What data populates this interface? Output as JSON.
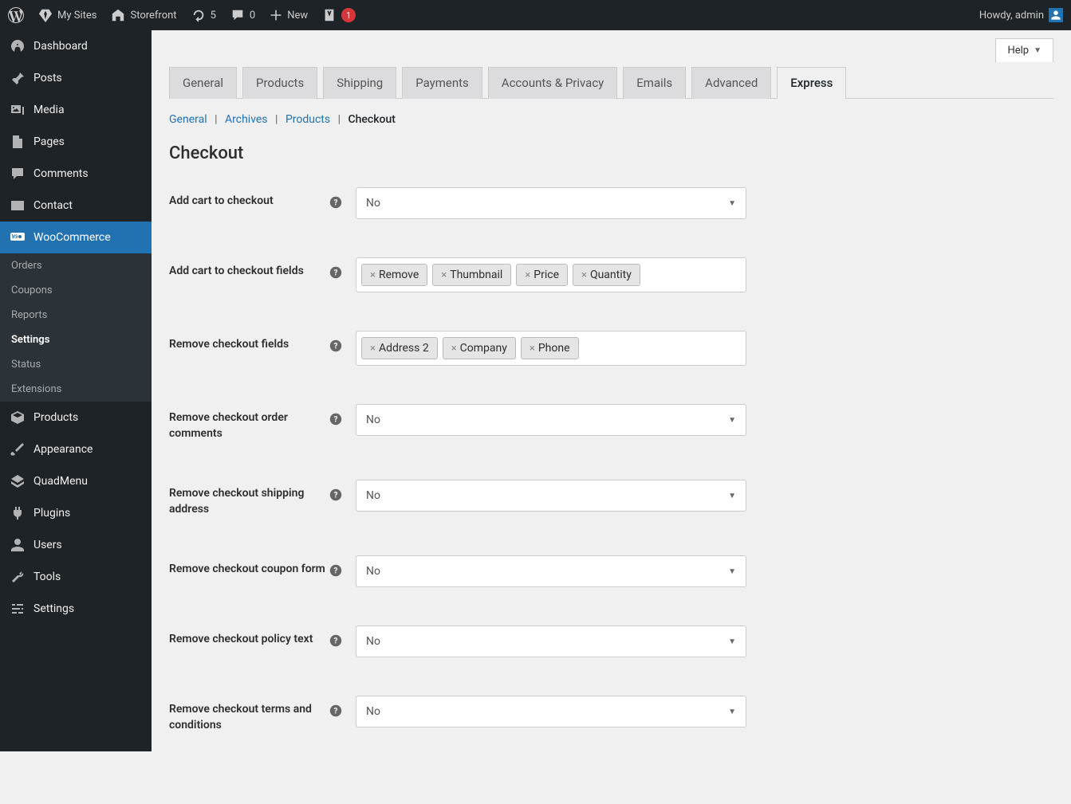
{
  "topbar": {
    "mysites": "My Sites",
    "site": "Storefront",
    "updates": "5",
    "comments": "0",
    "new": "New",
    "yoast_badge": "1",
    "howdy": "Howdy, admin"
  },
  "sidebar": {
    "items": [
      {
        "label": "Dashboard"
      },
      {
        "label": "Posts"
      },
      {
        "label": "Media"
      },
      {
        "label": "Pages"
      },
      {
        "label": "Comments"
      },
      {
        "label": "Contact"
      },
      {
        "label": "WooCommerce"
      },
      {
        "label": "Products"
      },
      {
        "label": "Appearance"
      },
      {
        "label": "QuadMenu"
      },
      {
        "label": "Plugins"
      },
      {
        "label": "Users"
      },
      {
        "label": "Tools"
      },
      {
        "label": "Settings"
      }
    ],
    "sub": [
      {
        "label": "Orders"
      },
      {
        "label": "Coupons"
      },
      {
        "label": "Reports"
      },
      {
        "label": "Settings"
      },
      {
        "label": "Status"
      },
      {
        "label": "Extensions"
      }
    ]
  },
  "help": "Help",
  "tabs": [
    "General",
    "Products",
    "Shipping",
    "Payments",
    "Accounts & Privacy",
    "Emails",
    "Advanced",
    "Express"
  ],
  "subtabs": {
    "general": "General",
    "archives": "Archives",
    "products": "Products",
    "checkout": "Checkout"
  },
  "section_title": "Checkout",
  "fields": {
    "add_cart": {
      "label": "Add cart to checkout",
      "value": "No"
    },
    "cart_fields": {
      "label": "Add cart to checkout fields",
      "tags": [
        "Remove",
        "Thumbnail",
        "Price",
        "Quantity"
      ]
    },
    "remove_fields": {
      "label": "Remove checkout fields",
      "tags": [
        "Address 2",
        "Company",
        "Phone"
      ]
    },
    "order_comments": {
      "label": "Remove checkout order comments",
      "value": "No"
    },
    "shipping_addr": {
      "label": "Remove checkout shipping address",
      "value": "No"
    },
    "coupon": {
      "label": "Remove checkout coupon form",
      "value": "No"
    },
    "policy": {
      "label": "Remove checkout policy text",
      "value": "No"
    },
    "terms": {
      "label": "Remove checkout terms and conditions",
      "value": "No"
    }
  }
}
